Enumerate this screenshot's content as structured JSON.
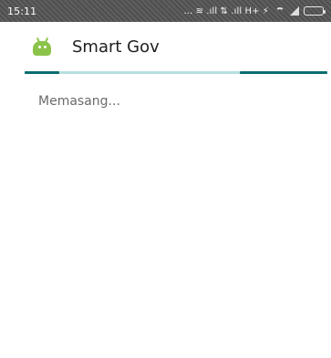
{
  "status_bar": {
    "time": "15:11",
    "indicators_text": "...  ≋ .ıll ⇅ .ıll H+ ⚡"
  },
  "app": {
    "title": "Smart Gov"
  },
  "content": {
    "status_message": "Memasang..."
  },
  "colors": {
    "status_bar_bg": "#555555",
    "progress_track": "#b7dfe0",
    "progress_indicator": "#0b6e6f",
    "android_green": "#8bc34a"
  },
  "icons": {
    "app_icon": "android-icon",
    "wifi": "wifi-icon",
    "signal": "signal-icon",
    "battery": "battery-icon"
  }
}
